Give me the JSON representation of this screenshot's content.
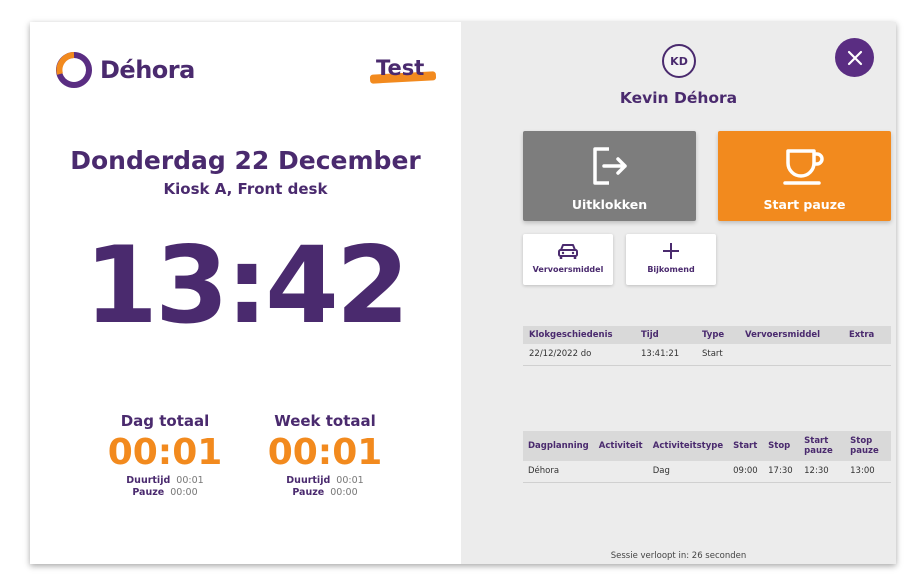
{
  "brand": {
    "name": "Déhora",
    "env_badge": "Test"
  },
  "left": {
    "date": "Donderdag 22 December",
    "location": "Kiosk A, Front desk",
    "clock": "13:42",
    "day_total": {
      "title": "Dag totaal",
      "value": "00:01",
      "duration_label": "Duurtijd",
      "duration_value": "00:01",
      "pause_label": "Pauze",
      "pause_value": "00:00"
    },
    "week_total": {
      "title": "Week totaal",
      "value": "00:01",
      "duration_label": "Duurtijd",
      "duration_value": "00:01",
      "pause_label": "Pauze",
      "pause_value": "00:00"
    }
  },
  "user": {
    "initials": "KD",
    "name": "Kevin Déhora"
  },
  "actions": {
    "clock_out": {
      "label": "Uitklokken",
      "icon": "logout-icon"
    },
    "start_pause": {
      "label": "Start pauze",
      "icon": "coffee-cup-icon"
    },
    "transport": {
      "label": "Vervoersmiddel",
      "icon": "car-icon"
    },
    "extra": {
      "label": "Bijkomend",
      "icon": "plus-icon"
    }
  },
  "history": {
    "headers": [
      "Klokgeschiedenis",
      "Tijd",
      "Type",
      "Vervoersmiddel",
      "Extra"
    ],
    "rows": [
      [
        "22/12/2022 do",
        "13:41:21",
        "Start",
        "",
        ""
      ]
    ]
  },
  "planning": {
    "headers": [
      "Dagplanning",
      "Activiteit",
      "Activiteitstype",
      "Start",
      "Stop",
      "Start pauze",
      "Stop pauze"
    ],
    "rows": [
      [
        "Déhora",
        "",
        "Dag",
        "09:00",
        "17:30",
        "12:30",
        "13:00"
      ]
    ]
  },
  "session": "Sessie verloopt in: 26 seconden",
  "colors": {
    "primary": "#4a2a6e",
    "accent": "#f28a1e",
    "close": "#5a2d82",
    "button_grey": "#7d7d7d",
    "panel_bg": "#ececec"
  }
}
